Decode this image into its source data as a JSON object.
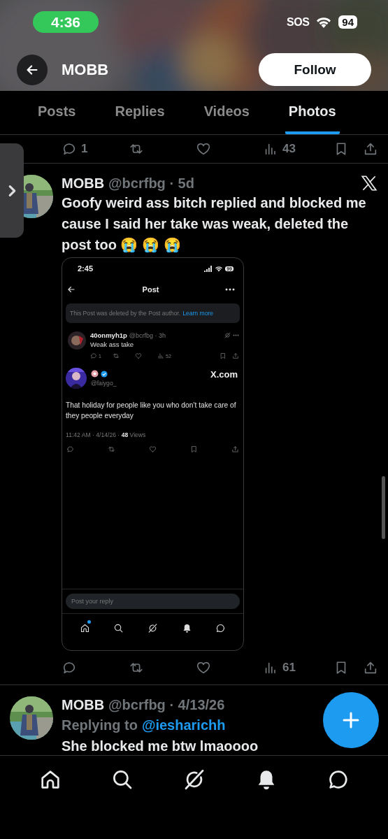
{
  "status_bar": {
    "time": "4:36",
    "carrier": "SOS",
    "battery": "94"
  },
  "header": {
    "title": "MOBB",
    "follow_button": "Follow"
  },
  "tabs": [
    {
      "label": "Posts",
      "selected": false
    },
    {
      "label": "Replies",
      "selected": false
    },
    {
      "label": "Videos",
      "selected": false
    },
    {
      "label": "Photos",
      "selected": true
    }
  ],
  "previous_post_actions": [
    {
      "kind": "reply",
      "count": "1"
    },
    {
      "kind": "repost"
    },
    {
      "kind": "like"
    },
    {
      "kind": "views",
      "count": "43"
    },
    {
      "kind": "bookmark"
    },
    {
      "kind": "share"
    }
  ],
  "posts": [
    {
      "name": "MOBB",
      "meta": "@bcrfbg · 5d",
      "text": "Goofy weird ass bitch replied and blocked me cause I said her take was weak, deleted the post too 😭 😭 😭",
      "embed": {
        "status_time": "2:45",
        "battery": "99",
        "title": "Post",
        "notice": "This Post was deleted by the Post author.",
        "notice_link": "Learn more",
        "reply": {
          "name": "40onmyh1p",
          "meta": "@bcrfbg · 3h",
          "text": "Weak ass take",
          "actions": [
            {
              "kind": "reply",
              "count": "1"
            },
            {
              "kind": "repost"
            },
            {
              "kind": "like"
            },
            {
              "kind": "views",
              "count": "52"
            },
            {
              "kind": "bookmark"
            },
            {
              "kind": "share"
            }
          ]
        },
        "post": {
          "verified": true,
          "handle": "@faiygo_",
          "source": "X.com",
          "text": "That holiday for people like you who don’t take care of they people everyday",
          "meta": "11:42 AM · 4/14/26 · **48** Views"
        },
        "actions": [
          {
            "kind": "reply"
          },
          {
            "kind": "repost"
          },
          {
            "kind": "like"
          },
          {
            "kind": "bookmark"
          },
          {
            "kind": "share"
          }
        ],
        "reply_placeholder": "Post your reply",
        "nav": [
          {
            "kind": "home",
            "badge": true
          },
          {
            "kind": "search",
            "badge": false
          },
          {
            "kind": "grok",
            "badge": false
          },
          {
            "kind": "bell",
            "badge": false
          },
          {
            "kind": "chat",
            "badge": false
          }
        ]
      },
      "actions": [
        {
          "kind": "reply"
        },
        {
          "kind": "repost"
        },
        {
          "kind": "like"
        },
        {
          "kind": "views",
          "count": "61"
        },
        {
          "kind": "bookmark"
        },
        {
          "kind": "share"
        }
      ]
    },
    {
      "name": "MOBB",
      "meta": "@bcrfbg · 4/13/26",
      "replying_to": "Replying to",
      "reply_handle": "@iesharichh",
      "text": "She blocked me btw lmaoooo"
    }
  ],
  "bottom_nav": [
    {
      "kind": "home"
    },
    {
      "kind": "search"
    },
    {
      "kind": "grok"
    },
    {
      "kind": "bell"
    },
    {
      "kind": "chat"
    }
  ]
}
